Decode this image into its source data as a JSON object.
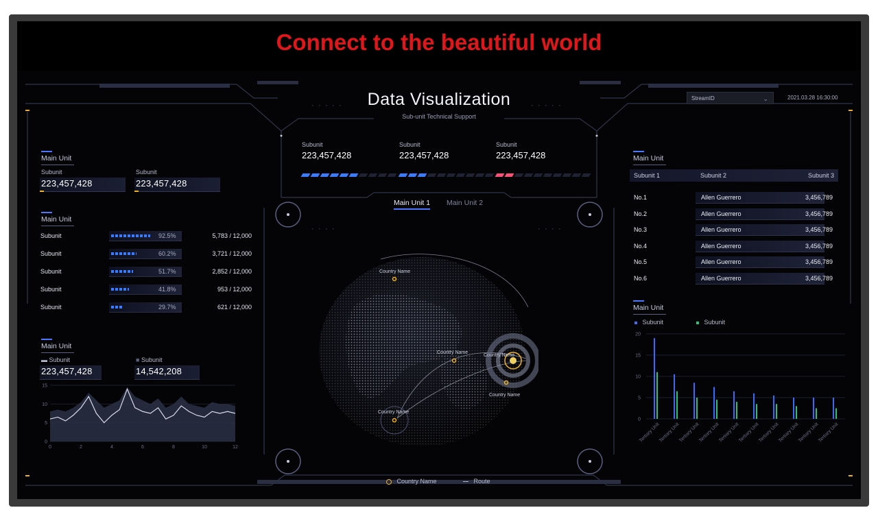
{
  "banner": "Connect to the beautiful world",
  "header": {
    "title": "Data Visualization",
    "subtitle": "Sub-unit Technical Support",
    "stream_select": "StreamID",
    "datetime": "2021.03.28 16:30:00"
  },
  "left": {
    "panel1": {
      "title": "Main Unit",
      "stats": [
        {
          "label": "Subunit",
          "value": "223,457,428"
        },
        {
          "label": "Subunit",
          "value": "223,457,428"
        }
      ]
    },
    "panel2": {
      "title": "Main Unit",
      "rows": [
        {
          "label": "Subunit",
          "percent": "92.5%",
          "count": "5,783 / 12,000",
          "fill": 0.925
        },
        {
          "label": "Subunit",
          "percent": "60.2%",
          "count": "3,721 / 12,000",
          "fill": 0.602
        },
        {
          "label": "Subunit",
          "percent": "51.7%",
          "count": "2,852 / 12,000",
          "fill": 0.517
        },
        {
          "label": "Subunit",
          "percent": "41.8%",
          "count": "953 / 12,000",
          "fill": 0.418
        },
        {
          "label": "Subunit",
          "percent": "29.7%",
          "count": "621 / 12,000",
          "fill": 0.297
        }
      ]
    },
    "panel3": {
      "title": "Main Unit",
      "stats": [
        {
          "label": "Subunit",
          "value": "223,457,428"
        },
        {
          "label": "Subunit",
          "value": "14,542,208"
        }
      ]
    }
  },
  "center": {
    "cards": [
      {
        "label": "Subunit",
        "value": "223,457,428",
        "level": 6,
        "color": "#3a7cff"
      },
      {
        "label": "Subunit",
        "value": "223,457,428",
        "level": 3,
        "color": "#3a7cff"
      },
      {
        "label": "Subunit",
        "value": "223,457,428",
        "level": 2,
        "color": "#ff4f7b"
      }
    ],
    "tabs": [
      "Main Unit 1",
      "Main Unit 2"
    ],
    "globe_labels": [
      "Country Name",
      "Country Name",
      "Country Name",
      "Country Name",
      "Country Name"
    ],
    "legend": {
      "country": "Country Name",
      "route": "Route"
    }
  },
  "right": {
    "table": {
      "title": "",
      "headers": [
        "Subunit 1",
        "Subunit 2",
        "Subunit 3"
      ],
      "rows": [
        {
          "rank": "No.1",
          "name": "Allen Guerrero",
          "value": "3,456,789"
        },
        {
          "rank": "No.2",
          "name": "Allen Guerrero",
          "value": "3,456,789"
        },
        {
          "rank": "No.3",
          "name": "Allen Guerrero",
          "value": "3,456,789"
        },
        {
          "rank": "No.4",
          "name": "Allen Guerrero",
          "value": "3,456,789"
        },
        {
          "rank": "No.5",
          "name": "Allen Guerrero",
          "value": "3,456,789"
        },
        {
          "rank": "No.6",
          "name": "Allen Guerrero",
          "value": "3,456,789"
        }
      ]
    },
    "panel_top": {
      "title": "Main Unit"
    },
    "panel_bottom": {
      "title": "Main Unit"
    },
    "legend": [
      "Subunit",
      "Subunit"
    ]
  },
  "colors": {
    "accent": "#4a79ff",
    "gold": "#f0b224",
    "pink": "#ff4f7b",
    "green": "#2ec27e",
    "banner": "#e0161a"
  },
  "chart_data": [
    {
      "type": "line",
      "x": [
        0,
        0.5,
        1,
        1.5,
        2,
        2.5,
        3,
        3.5,
        4,
        4.5,
        5,
        5.5,
        6,
        6.5,
        7,
        7.5,
        8,
        8.5,
        9,
        9.5,
        10,
        10.5,
        11,
        11.5,
        12
      ],
      "series": [
        {
          "name": "Subunit",
          "values": [
            6,
            6.5,
            5.5,
            7,
            9,
            12,
            7.5,
            5,
            7,
            8.5,
            14,
            9,
            8,
            7.5,
            9,
            6,
            7,
            9.5,
            8,
            7,
            6.5,
            8,
            7.5,
            8,
            7.5
          ]
        },
        {
          "name": "Subunit",
          "values": [
            8,
            8.5,
            8,
            9,
            10.5,
            13,
            11,
            9,
            10,
            11,
            14.5,
            12,
            11,
            10,
            11.5,
            9,
            10,
            12,
            10,
            9.5,
            9,
            10.5,
            10,
            10,
            9.5
          ]
        }
      ],
      "xticks": [
        0,
        2,
        4,
        6,
        8,
        10,
        12
      ],
      "yticks": [
        0,
        5,
        10,
        15
      ],
      "ylim": [
        0,
        15
      ],
      "xlim": [
        0,
        12
      ]
    },
    {
      "type": "bar",
      "categories": [
        "Tertiary Unit",
        "Tertiary Unit",
        "Tertiary Unit",
        "Tertiary Unit",
        "Tertiary Unit",
        "Tertiary Unit",
        "Tertiary Unit",
        "Tertiary Unit",
        "Tertiary Unit",
        "Tertiary Unit"
      ],
      "series": [
        {
          "name": "Subunit",
          "values": [
            19,
            10.5,
            8.5,
            7.5,
            6.5,
            6,
            5.5,
            5,
            5,
            5
          ]
        },
        {
          "name": "Subunit",
          "values": [
            11,
            6.5,
            5,
            4.5,
            4,
            3.5,
            3.5,
            3,
            2.5,
            2.5
          ]
        }
      ],
      "yticks": [
        0,
        5,
        10,
        15,
        20
      ],
      "ylim": [
        0,
        20
      ],
      "legend": "top-left"
    }
  ]
}
